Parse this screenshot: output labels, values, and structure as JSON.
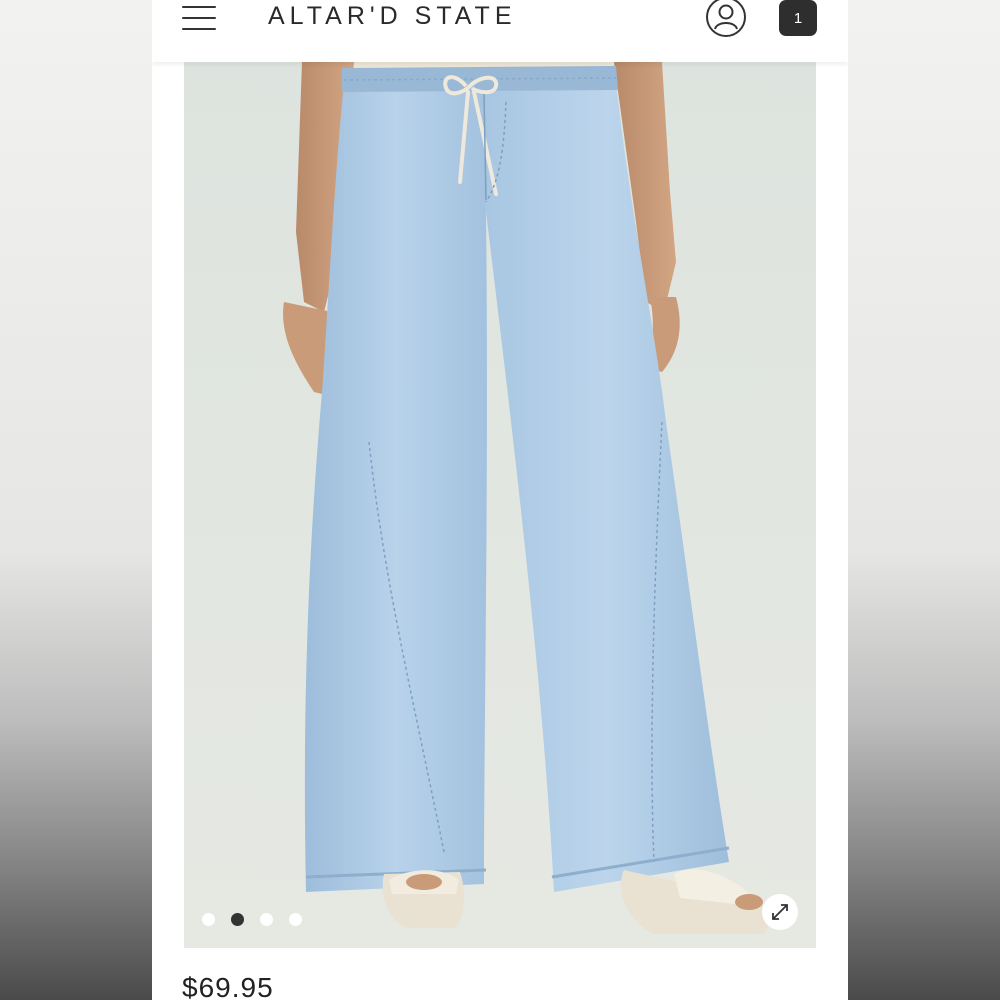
{
  "header": {
    "brand": "ALTAR'D STATE",
    "menu_icon": "hamburger-menu-icon",
    "account_icon": "user-account-icon",
    "cart_count": "1"
  },
  "gallery": {
    "slide_count": 4,
    "active_index": 1,
    "expand_icon": "expand-arrows-icon"
  },
  "product": {
    "price": "$69.95"
  },
  "colors": {
    "denim": "#a9c7e2",
    "denim_dark": "#8fb3d4",
    "backdrop": "#e2e6e0",
    "cart_bg": "#2e2e2e",
    "text": "#2a2a2a"
  }
}
